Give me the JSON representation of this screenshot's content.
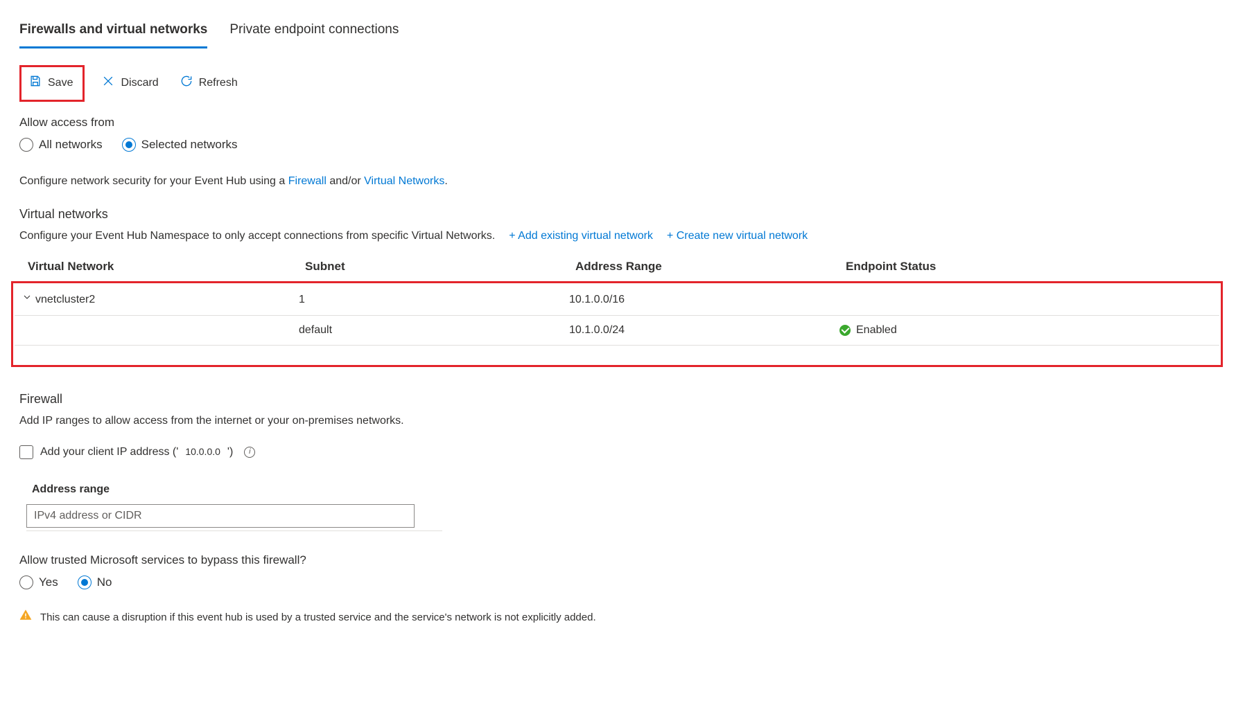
{
  "tabs": {
    "firewalls": "Firewalls and virtual networks",
    "private": "Private endpoint connections"
  },
  "toolbar": {
    "save": "Save",
    "discard": "Discard",
    "refresh": "Refresh"
  },
  "access": {
    "label": "Allow access from",
    "all": "All networks",
    "selected": "Selected networks"
  },
  "configure": {
    "prefix": "Configure network security for your Event Hub using a ",
    "firewall_link": "Firewall",
    "andor": " and/or ",
    "vnet_link": "Virtual Networks",
    "suffix": "."
  },
  "vnet": {
    "title": "Virtual networks",
    "desc": "Configure your Event Hub Namespace to only accept connections from specific Virtual Networks.",
    "add_existing": "+ Add existing virtual network",
    "create_new": "+ Create new virtual network",
    "columns": {
      "network": "Virtual Network",
      "subnet": "Subnet",
      "range": "Address Range",
      "status": "Endpoint Status"
    },
    "rows": [
      {
        "name": "vnetcluster2",
        "subnet": "1",
        "range": "10.1.0.0/16",
        "status": ""
      },
      {
        "name": "",
        "subnet": "default",
        "range": "10.1.0.0/24",
        "status": "Enabled"
      }
    ]
  },
  "firewall": {
    "title": "Firewall",
    "desc": "Add IP ranges to allow access from the internet or your on-premises networks.",
    "add_ip_prefix": "Add your client IP address (' ",
    "add_ip_value": "10.0.0.0",
    "add_ip_suffix": "  ')",
    "address_range_label": "Address range",
    "address_range_placeholder": "IPv4 address or CIDR"
  },
  "bypass": {
    "label": "Allow trusted Microsoft services to bypass this firewall?",
    "yes": "Yes",
    "no": "No",
    "warning": "This can cause a disruption if this event hub is used by a trusted service and the service's network is not explicitly added."
  }
}
